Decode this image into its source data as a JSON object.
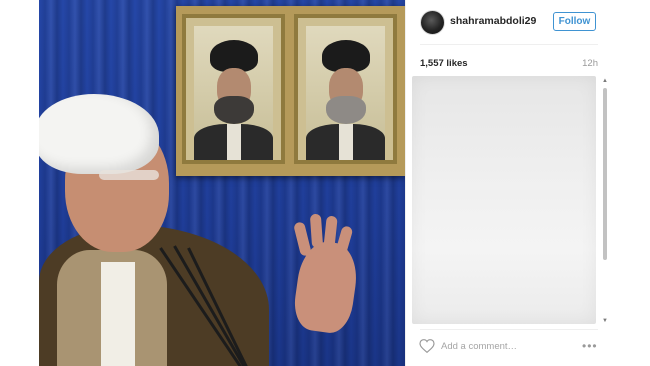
{
  "post": {
    "username": "shahramabdoli29",
    "follow_label": "Follow",
    "likes": "1,557 likes",
    "time": "12h"
  },
  "comment": {
    "placeholder": "Add a comment…"
  },
  "icons": {
    "heart": "heart-icon",
    "more": "more-options-icon",
    "avatar": "profile-avatar"
  },
  "colors": {
    "follow_accent": "#3f93d2",
    "curtain_blue": "#1f3f9e"
  }
}
